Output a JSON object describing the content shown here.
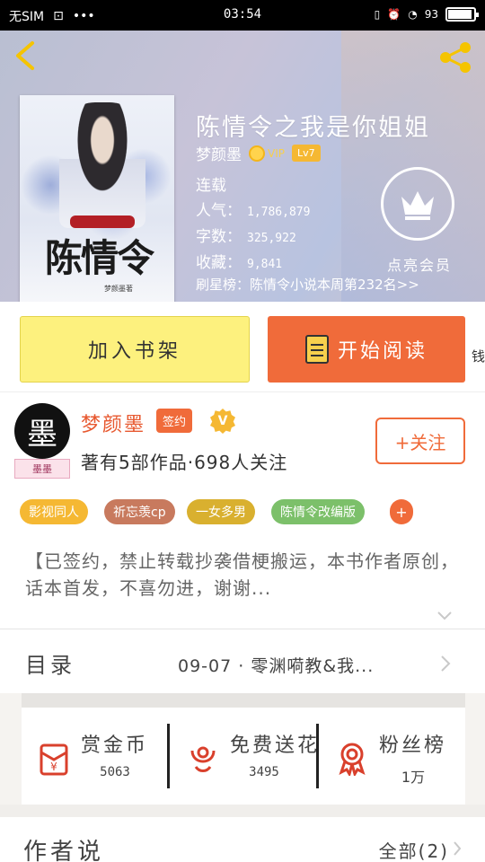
{
  "status_bar": {
    "carrier": "无SIM",
    "time": "03:54",
    "battery": "93",
    "battery_level": 0.93
  },
  "colors": {
    "accent": "#f06b3a",
    "shelf_button": "#fdf17e",
    "title_text": "#ffffff"
  },
  "icons": {
    "back": "chevron-left-icon",
    "share": "share-icon",
    "member": "crown-icon"
  },
  "book": {
    "title": "陈情令之我是你姐姐",
    "author": "梦颜墨",
    "vip_label": "VIP",
    "level": "Lv7",
    "status": "连载",
    "popularity_label": "人气：",
    "popularity": "1,786,879",
    "words_label": "字数：",
    "words": "325,922",
    "collections_label": "收藏：",
    "collections": "9,841",
    "rank": "刷星榜：陈情令小说本周第232名>>",
    "member_label": "点亮会员",
    "cover_title": "陈情令",
    "cover_author": "梦颜墨著"
  },
  "actions": {
    "add_to_shelf": "加入书架",
    "start_reading": "开始阅读",
    "money_tab": "钱"
  },
  "author": {
    "avatar_char": "墨",
    "avatar_tag": "墨墨",
    "name": "梦颜墨",
    "signed": "签约",
    "verified": "V",
    "works": "著有5部作品·698人关注",
    "follow": "+关注"
  },
  "tags": [
    {
      "label": "影视同人",
      "color": "#f5b833"
    },
    {
      "label": "祈忘羡cp",
      "color": "#c87a5e"
    },
    {
      "label": "一女多男",
      "color": "#d9b02f"
    },
    {
      "label": "陈情令改编版",
      "color": "#7cc06a"
    }
  ],
  "tag_more": "+",
  "intro": {
    "text": "【已签约，禁止转载抄袭借梗搬运，本书作者原创，话本首发，不喜勿进，谢谢..."
  },
  "toc": {
    "label": "目录",
    "latest": "09-07 · 零渊嗬教&我..."
  },
  "stats": [
    {
      "name": "赏金币",
      "value": "5063"
    },
    {
      "name": "免费送花",
      "value": "3495"
    },
    {
      "name": "粉丝榜",
      "value": "1万"
    }
  ],
  "author_says": {
    "label": "作者说",
    "all": "全部(2)"
  }
}
